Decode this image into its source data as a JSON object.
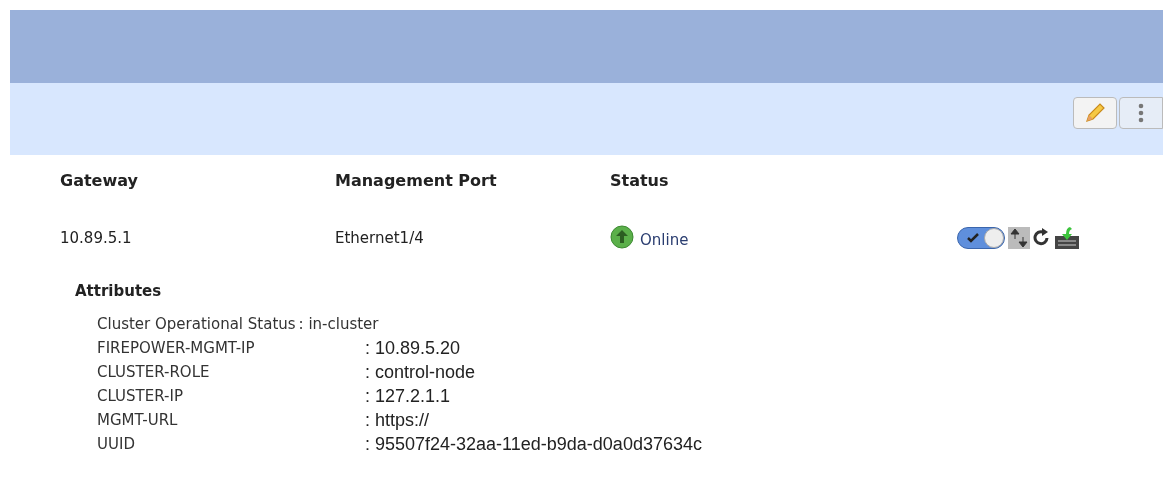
{
  "columns": [
    "Gateway",
    "Management Port",
    "Status"
  ],
  "row": {
    "gateway": "10.89.5.1",
    "port": "Ethernet1/4",
    "status": "Online",
    "enabled": true
  },
  "attributes_title": "Attributes",
  "attributes": [
    {
      "name": "Cluster Operational Status",
      "value": ": in-cluster",
      "kind": "small"
    },
    {
      "name": "FIREPOWER-MGMT-IP",
      "value": ": 10.89.5.20",
      "kind": "large"
    },
    {
      "name": "CLUSTER-ROLE",
      "value": ": control-node",
      "kind": "large"
    },
    {
      "name": "CLUSTER-IP",
      "value": ": 127.2.1.1",
      "kind": "large"
    },
    {
      "name": "MGMT-URL",
      "value": ": https://",
      "kind": "large"
    },
    {
      "name": "UUID",
      "value": ": 95507f24-32aa-11ed-b9da-d0a0d37634c",
      "kind": "large"
    }
  ]
}
